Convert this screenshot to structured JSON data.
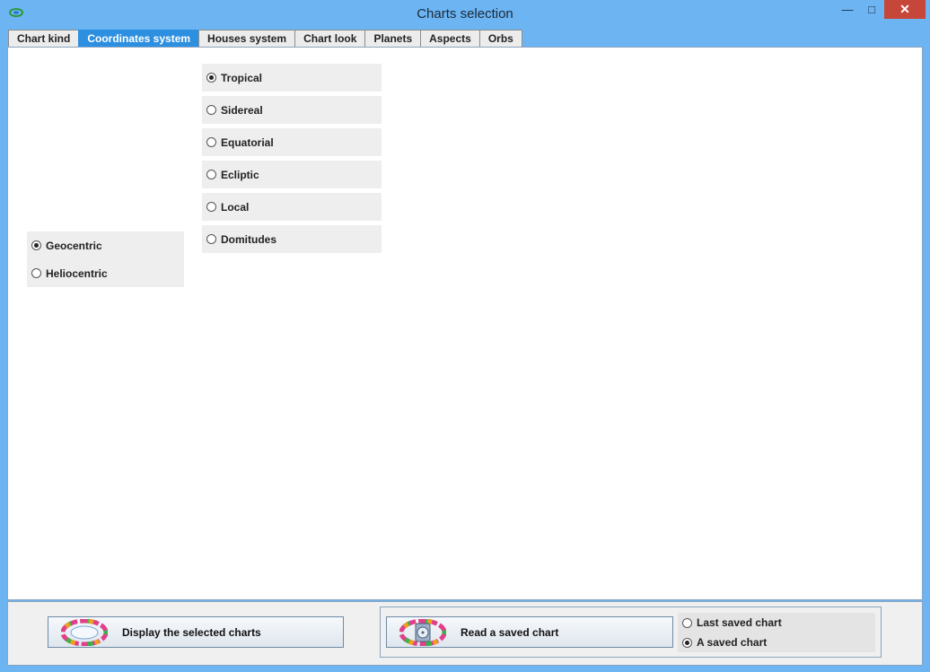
{
  "window": {
    "title": "Charts selection",
    "minimize_glyph": "—",
    "maximize_glyph": "□",
    "close_glyph": "✕"
  },
  "tabs": [
    {
      "label": "Chart kind",
      "active": false
    },
    {
      "label": "Coordinates system",
      "active": true
    },
    {
      "label": "Houses system",
      "active": false
    },
    {
      "label": "Chart look",
      "active": false
    },
    {
      "label": "Planets",
      "active": false
    },
    {
      "label": "Aspects",
      "active": false
    },
    {
      "label": "Orbs",
      "active": false
    }
  ],
  "coordinates": {
    "options": [
      {
        "label": "Tropical",
        "selected": true
      },
      {
        "label": "Sidereal",
        "selected": false
      },
      {
        "label": "Equatorial",
        "selected": false
      },
      {
        "label": "Ecliptic",
        "selected": false
      },
      {
        "label": "Local",
        "selected": false
      },
      {
        "label": "Domitudes",
        "selected": false
      }
    ]
  },
  "centric": {
    "options": [
      {
        "label": "Geocentric",
        "selected": true
      },
      {
        "label": "Heliocentric",
        "selected": false
      }
    ]
  },
  "bottom": {
    "display_button": "Display the selected charts",
    "read_button": "Read a saved chart",
    "saved_options": [
      {
        "label": "Last saved chart",
        "selected": false
      },
      {
        "label": "A saved chart",
        "selected": true
      }
    ]
  },
  "colors": {
    "titlebar": "#6cb4f2",
    "active_tab": "#2c8fe0",
    "close_button": "#c7463a"
  },
  "icons": {
    "app": "app-wheel-icon",
    "chart_wheel": "chart-wheel-icon",
    "disk": "disk-icon"
  }
}
